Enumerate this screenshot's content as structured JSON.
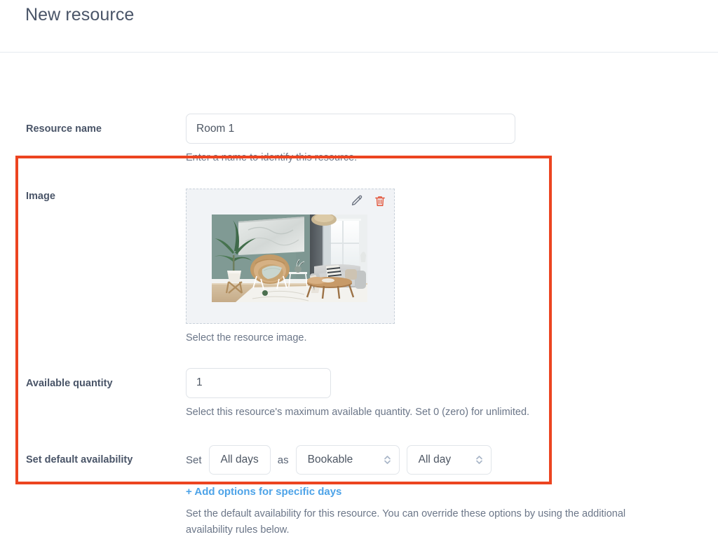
{
  "header": {
    "title": "New resource"
  },
  "highlight": {
    "color": "#ec4420"
  },
  "fields": {
    "resource_name": {
      "label": "Resource name",
      "value": "Room 1",
      "placeholder": "",
      "help": "Enter a name to identify this resource."
    },
    "image": {
      "label": "Image",
      "help": "Select the resource image.",
      "edit_icon": "pencil-icon",
      "delete_icon": "trash-icon",
      "delete_icon_color": "#e2543a",
      "edit_icon_color": "#6b7280",
      "thumbnail_alt": "Living room with sage green wall, rattan chair, potted palm, grey sofa and wooden coffee table"
    },
    "available_quantity": {
      "label": "Available quantity",
      "value": "1",
      "placeholder": "",
      "help": "Select this resource's maximum available quantity. Set 0 (zero) for unlimited."
    },
    "default_availability": {
      "label": "Set default availability",
      "prefix_word": "Set",
      "days_value": "All days",
      "middle_word": "as",
      "status_value": "Bookable",
      "time_value": "All day",
      "add_link": "+ Add options for specific days",
      "add_link_color": "#4da3e8",
      "help": "Set the default availability for this resource. You can override these options by using the additional availability rules below."
    }
  }
}
